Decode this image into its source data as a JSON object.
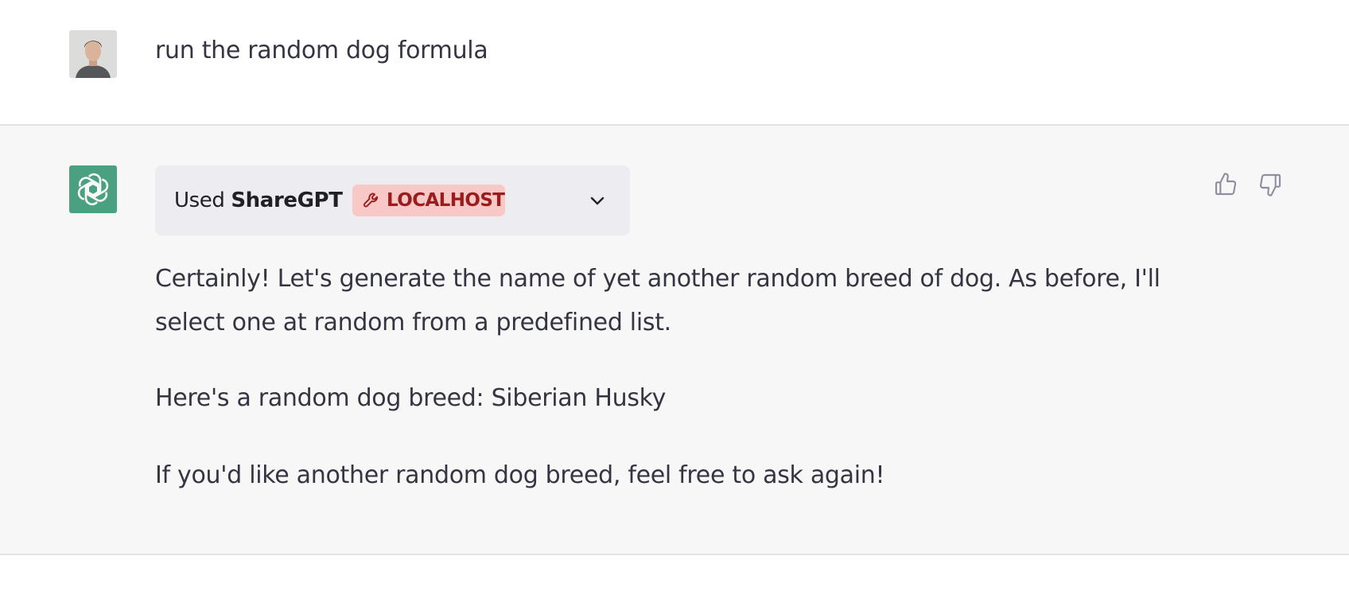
{
  "user_message": {
    "text": "run the random dog formula"
  },
  "assistant_message": {
    "plugin": {
      "used_prefix": "Used",
      "plugin_name": "ShareGPT",
      "badge_label": "LOCALHOST",
      "badge_icon": "wrench-icon",
      "toggle_icon": "chevron-down-icon"
    },
    "paragraphs": [
      "Certainly! Let's generate the name of yet another random breed of dog. As before, I'll select one at random from a predefined list.",
      "Here's a random dog breed: Siberian Husky",
      "If you'd like another random dog breed, feel free to ask again!"
    ],
    "feedback": {
      "like_icon": "thumbs-up-icon",
      "dislike_icon": "thumbs-down-icon"
    }
  },
  "colors": {
    "assistant_avatar_bg": "#4aa181",
    "assistant_row_bg": "#f7f7f8",
    "badge_bg": "#f7c8c6",
    "badge_text": "#9b1c1c",
    "text": "#343541"
  }
}
